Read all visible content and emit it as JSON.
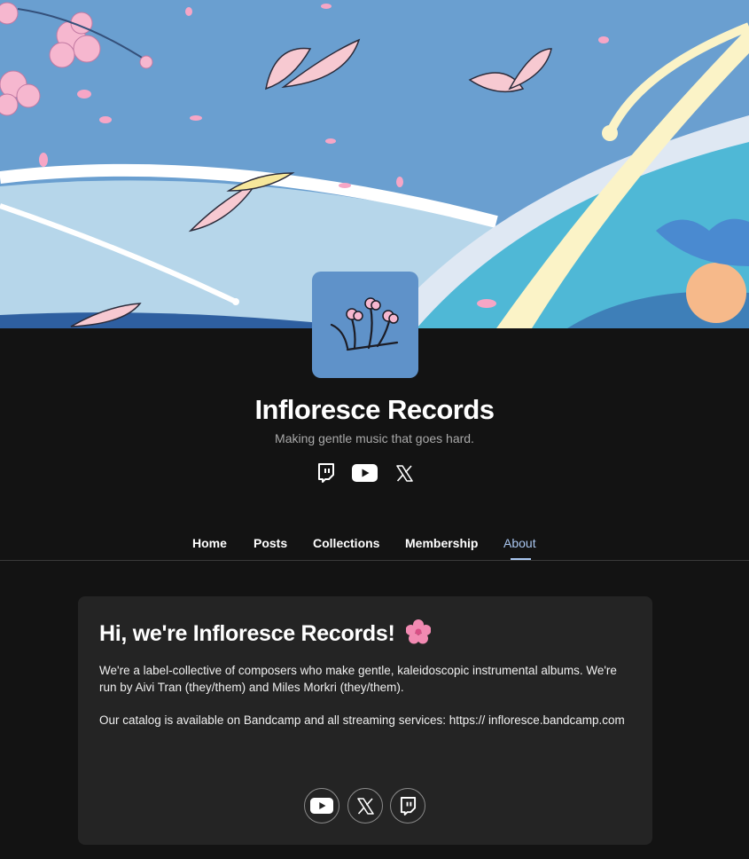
{
  "profile": {
    "name": "Infloresce Records",
    "tagline": "Making gentle music that goes hard."
  },
  "header_socials": [
    "twitch-icon",
    "youtube-icon",
    "x-icon"
  ],
  "tabs": [
    {
      "label": "Home"
    },
    {
      "label": "Posts"
    },
    {
      "label": "Collections"
    },
    {
      "label": "Membership"
    },
    {
      "label": "About",
      "active": true
    }
  ],
  "about": {
    "title": "Hi, we're Infloresce Records!",
    "title_emoji": "cherry-blossom-icon",
    "paragraphs": [
      "We're a label-collective of composers who make gentle, kaleidoscopic instrumental albums. We're run by Aivi Tran (they/them) and Miles Morkri (they/them).",
      "Our catalog is available on Bandcamp and all streaming services: https:// infloresce.bandcamp.com"
    ],
    "social_buttons": [
      "youtube-icon",
      "x-icon",
      "twitch-icon"
    ]
  },
  "colors": {
    "background": "#131313",
    "card": "#242424",
    "active_tab": "#a9c6ef",
    "avatar_bg": "#5f92c9",
    "banner_sky": "#6a9fd0"
  }
}
